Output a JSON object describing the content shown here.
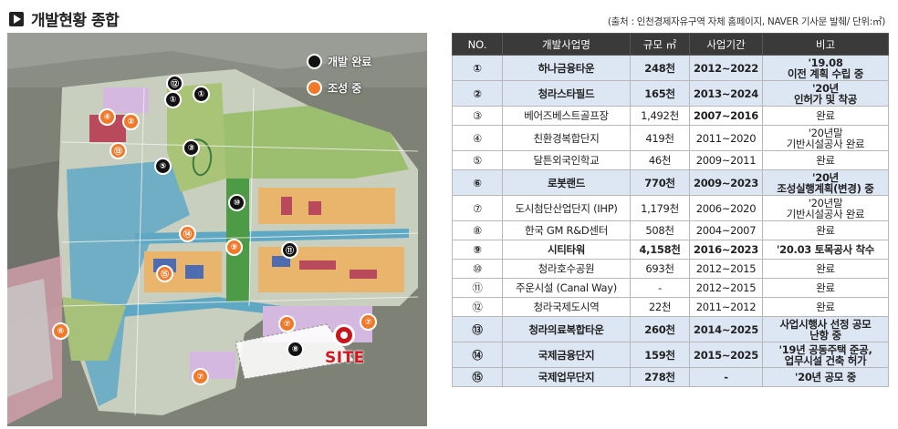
{
  "header": {
    "title": "개발현황 종합",
    "source": "(출처 : 인천경제자유구역 자체 홈페이지, NAVER 기사문 발췌/ 단위:㎡)"
  },
  "map": {
    "legend": {
      "complete": "개발 완료",
      "in_progress": "조성 중"
    },
    "site_label": "SITE",
    "markers": [
      {
        "num": "⑫",
        "status": "complete"
      },
      {
        "num": "①",
        "status": "complete"
      },
      {
        "num": "①",
        "status": "complete"
      },
      {
        "num": "④",
        "status": "in_progress"
      },
      {
        "num": "②",
        "status": "in_progress"
      },
      {
        "num": "⑬",
        "status": "in_progress"
      },
      {
        "num": "③",
        "status": "complete"
      },
      {
        "num": "⑤",
        "status": "complete"
      },
      {
        "num": "⑩",
        "status": "complete"
      },
      {
        "num": "⑭",
        "status": "in_progress"
      },
      {
        "num": "⑨",
        "status": "in_progress"
      },
      {
        "num": "⑪",
        "status": "complete"
      },
      {
        "num": "⑮",
        "status": "in_progress"
      },
      {
        "num": "⑥",
        "status": "in_progress"
      },
      {
        "num": "⑦",
        "status": "in_progress"
      },
      {
        "num": "⑦",
        "status": "in_progress"
      },
      {
        "num": "⑧",
        "status": "complete"
      },
      {
        "num": "⑦",
        "status": "in_progress"
      }
    ]
  },
  "table": {
    "headers": [
      "NO.",
      "개발사업명",
      "규모 ㎡",
      "사업기간",
      "비고"
    ],
    "rows": [
      {
        "no": "①",
        "name": "하나금융타운",
        "size": "248천",
        "period": "2012~2022",
        "note1": "'19.08",
        "note2": "이전 계획 수립 중"
      },
      {
        "no": "②",
        "name": "청라스타필드",
        "size": "165천",
        "period": "2013~2024",
        "note1": "'20년",
        "note2": "인허가 및 착공"
      },
      {
        "no": "③",
        "name": "베어즈베스트골프장",
        "size": "1,492천",
        "period": "2007~2016",
        "note1": "완료",
        "note2": ""
      },
      {
        "no": "④",
        "name": "친환경복합단지",
        "size": "419천",
        "period": "2011~2020",
        "note1": "'20년말",
        "note2": "기반시설공사 완료"
      },
      {
        "no": "⑤",
        "name": "달튼외국인학교",
        "size": "46천",
        "period": "2009~2011",
        "note1": "완료",
        "note2": ""
      },
      {
        "no": "⑥",
        "name": "로봇랜드",
        "size": "770천",
        "period": "2009~2023",
        "note1": "'20년",
        "note2": "조성실행계획(변경) 중"
      },
      {
        "no": "⑦",
        "name": "도시첨단산업단지 (IHP)",
        "size": "1,179천",
        "period": "2006~2020",
        "note1": "'20년말",
        "note2": "기반시설공사 완료"
      },
      {
        "no": "⑧",
        "name": "한국 GM R&D센터",
        "size": "508천",
        "period": "2004~2007",
        "note1": "완료",
        "note2": ""
      },
      {
        "no": "⑨",
        "name": "시티타워",
        "size": "4,158천",
        "period": "2016~2023",
        "note1": "'20.03 토목공사 착수",
        "note2": ""
      },
      {
        "no": "⑩",
        "name": "청라호수공원",
        "size": "693천",
        "period": "2012~2015",
        "note1": "완료",
        "note2": ""
      },
      {
        "no": "⑪",
        "name": "주운시설 (Canal Way)",
        "size": "-",
        "period": "2012~2015",
        "note1": "완료",
        "note2": ""
      },
      {
        "no": "⑫",
        "name": "청라국제도시역",
        "size": "22천",
        "period": "2011~2012",
        "note1": "완료",
        "note2": ""
      },
      {
        "no": "⑬",
        "name": "청라의료복합타운",
        "size": "260천",
        "period": "2014~2025",
        "note1": "사업시행사 선정 공모",
        "note2": "난항 중"
      },
      {
        "no": "⑭",
        "name": "국제금융단지",
        "size": "159천",
        "period": "2015~2025",
        "note1": "'19년 공동주택 준공,",
        "note2": "업무시설 건축 허가"
      },
      {
        "no": "⑮",
        "name": "국제업무단지",
        "size": "278천",
        "period": "-",
        "note1": "'20년 공모 중",
        "note2": ""
      }
    ]
  }
}
